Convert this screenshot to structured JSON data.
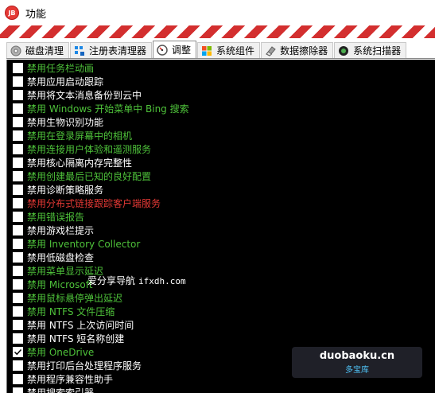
{
  "window": {
    "title": "功能",
    "icon": "app-logo-icon"
  },
  "tabs": [
    {
      "label": "磁盘清理",
      "icon": "disk-icon",
      "active": false
    },
    {
      "label": "注册表清理器",
      "icon": "registry-icon",
      "active": false
    },
    {
      "label": "调整",
      "icon": "tweak-gauge-icon",
      "active": true
    },
    {
      "label": "系统组件",
      "icon": "windows-icon",
      "active": false
    },
    {
      "label": "数据擦除器",
      "icon": "eraser-icon",
      "active": false
    },
    {
      "label": "系统扫描器",
      "icon": "scanner-icon",
      "active": false
    }
  ],
  "items": [
    {
      "label": "禁用任务栏动画",
      "color": "green",
      "checked": false
    },
    {
      "label": "禁用应用启动跟踪",
      "color": "white",
      "checked": false
    },
    {
      "label": "禁用将文本消息备份到云中",
      "color": "white",
      "checked": false
    },
    {
      "label": "禁用 Windows 开始菜单中 Bing 搜索",
      "color": "green",
      "checked": false
    },
    {
      "label": "禁用生物识别功能",
      "color": "white",
      "checked": false
    },
    {
      "label": "禁用在登录屏幕中的相机",
      "color": "green",
      "checked": false
    },
    {
      "label": "禁用连接用户体验和遥测服务",
      "color": "green",
      "checked": false
    },
    {
      "label": "禁用核心隔离内存完整性",
      "color": "white",
      "checked": false
    },
    {
      "label": "禁用创建最后已知的良好配置",
      "color": "green",
      "checked": false
    },
    {
      "label": "禁用诊断策略服务",
      "color": "white",
      "checked": false
    },
    {
      "label": "禁用分布式链接跟踪客户端服务",
      "color": "red",
      "checked": false
    },
    {
      "label": "禁用错误报告",
      "color": "green",
      "checked": false
    },
    {
      "label": "禁用游戏栏提示",
      "color": "white",
      "checked": false
    },
    {
      "label": "禁用 Inventory Collector",
      "color": "green",
      "checked": false
    },
    {
      "label": "禁用低磁盘检查",
      "color": "white",
      "checked": false
    },
    {
      "label": "禁用菜单显示延迟",
      "color": "green",
      "checked": false
    },
    {
      "label": "禁用 Microsoft",
      "color": "green",
      "checked": false
    },
    {
      "label": "禁用鼠标悬停弹出延迟",
      "color": "green",
      "checked": false
    },
    {
      "label": "禁用 NTFS 文件压缩",
      "color": "green",
      "checked": false
    },
    {
      "label": "禁用 NTFS 上次访问时间",
      "color": "white",
      "checked": false
    },
    {
      "label": "禁用 NTFS 短名称创建",
      "color": "white",
      "checked": false
    },
    {
      "label": "禁用 OneDrive",
      "color": "green",
      "checked": true
    },
    {
      "label": "禁用打印后台处理程序服务",
      "color": "white",
      "checked": false
    },
    {
      "label": "禁用程序兼容性助手",
      "color": "white",
      "checked": false
    },
    {
      "label": "禁用搜索索引器",
      "color": "white",
      "checked": false
    }
  ],
  "watermarks": {
    "overlay_text": "爱分享导航",
    "overlay_site": "ifxdh.com",
    "badge_main": "duobaoku.cn",
    "badge_sub": "多宝库"
  },
  "colors": {
    "green": "#4ec23a",
    "white": "#ffffff",
    "red": "#e53935",
    "list_background": "#000000",
    "stripe_red": "#d32f2f"
  }
}
